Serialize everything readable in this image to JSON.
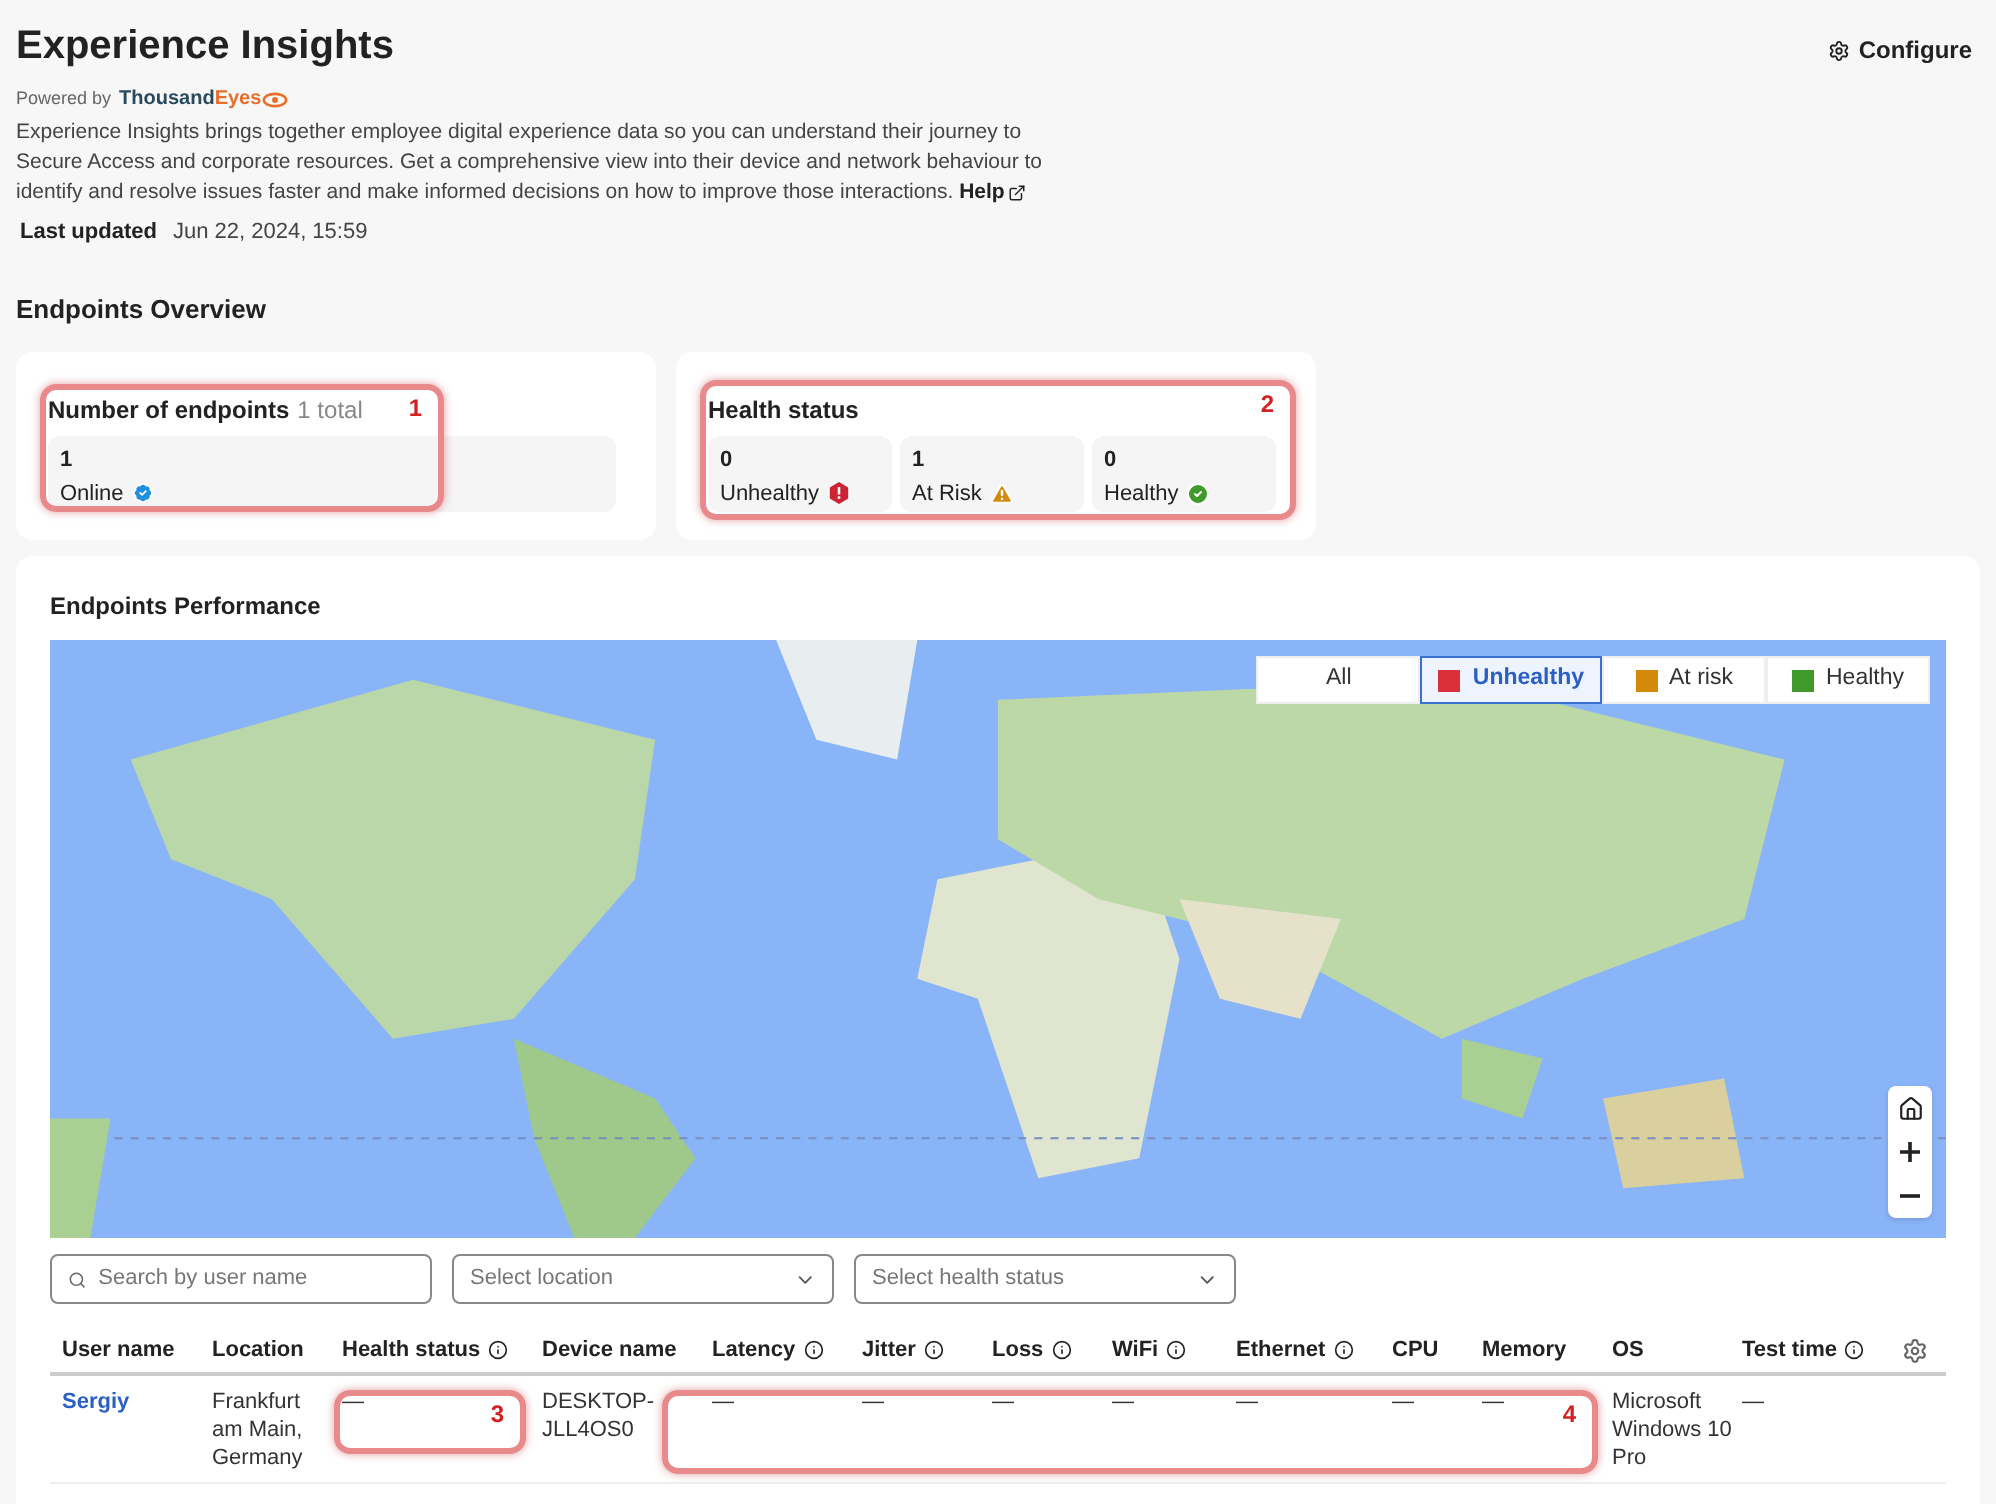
{
  "header": {
    "title": "Experience Insights",
    "configure": "Configure",
    "powered_by": "Powered by",
    "brand_dark": "Thousand",
    "brand_accent": "Eyes",
    "description": "Experience Insights brings together employee digital experience data so you can understand their journey to Secure Access and corporate resources. Get a comprehensive view into their device and network behaviour to identify and resolve issues faster and make informed decisions on how to improve those interactions.",
    "help": "Help",
    "last_updated_label": "Last updated",
    "last_updated": "Jun 22, 2024, 15:59"
  },
  "overview_title": "Endpoints Overview",
  "endpoints_card": {
    "title": "Number of endpoints",
    "total": "1 total",
    "count": "1",
    "label": "Online",
    "annotation": "1"
  },
  "health_card": {
    "title": "Health status",
    "annotation": "2",
    "items": [
      {
        "kind": "unhealthy",
        "count": "0",
        "label": "Unhealthy"
      },
      {
        "kind": "risk",
        "count": "1",
        "label": "At Risk"
      },
      {
        "kind": "healthy",
        "count": "0",
        "label": "Healthy"
      }
    ]
  },
  "performance": {
    "title": "Endpoints Performance",
    "map": {
      "kind": "picture",
      "legend": [
        {
          "label": "All",
          "selected": false
        },
        {
          "label": "Unhealthy",
          "selected": true,
          "color": "#d9303a"
        },
        {
          "label": "At risk",
          "selected": false,
          "color": "#d4890a"
        },
        {
          "label": "Healthy",
          "selected": false,
          "color": "#3f9a2b"
        }
      ]
    },
    "search": {
      "placeholder": "Search by user name"
    },
    "filters": [
      {
        "placeholder": "Select location"
      },
      {
        "placeholder": "Select health status"
      }
    ],
    "table": {
      "columns": [
        {
          "label": "User name",
          "info": false
        },
        {
          "label": "Location",
          "info": false
        },
        {
          "label": "Health status",
          "info": true
        },
        {
          "label": "Device name",
          "info": false
        },
        {
          "label": "Latency",
          "info": true
        },
        {
          "label": "Jitter",
          "info": true
        },
        {
          "label": "Loss",
          "info": true
        },
        {
          "label": "WiFi",
          "info": true
        },
        {
          "label": "Ethernet",
          "info": true
        },
        {
          "label": "CPU",
          "info": false
        },
        {
          "label": "Memory",
          "info": false
        },
        {
          "label": "OS",
          "info": false
        },
        {
          "label": "Test time",
          "info": true
        }
      ],
      "rows": [
        {
          "cells": [
            "Sergiy",
            "Frankfurt am Main, Germany",
            "—",
            "DESKTOP-JLL4OS0",
            "—",
            "—",
            "—",
            "—",
            "—",
            "—",
            "—",
            "Microsoft Windows 10 Pro",
            "—"
          ]
        }
      ],
      "annotations": [
        "3",
        "4"
      ]
    }
  }
}
